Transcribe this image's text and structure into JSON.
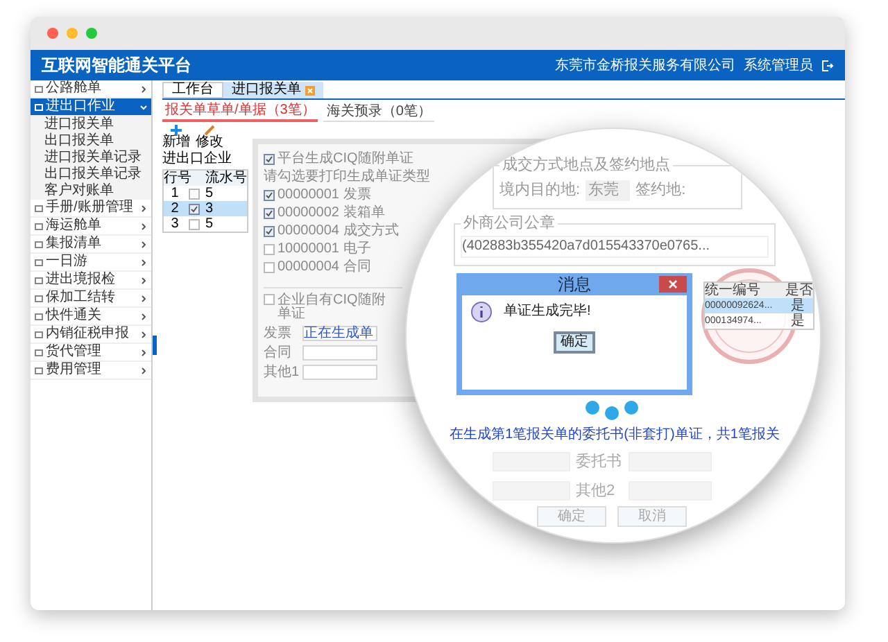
{
  "browser": {
    "dots": [
      {
        "color": "#ff5f57"
      },
      {
        "color": "#ffbd2e"
      },
      {
        "color": "#28c840"
      }
    ]
  },
  "header": {
    "title": "互联网智能通关平台",
    "company": "东莞市金桥报关服务有限公司",
    "user": "系统管理员"
  },
  "sidebar": [
    {
      "label": "公路舱单",
      "expanded": false,
      "selected": false
    },
    {
      "label": "进出口作业",
      "expanded": true,
      "selected": true,
      "children": [
        {
          "label": "进口报关单"
        },
        {
          "label": "出口报关单"
        },
        {
          "label": "进口报关单记录"
        },
        {
          "label": "出口报关单记录"
        },
        {
          "label": "客户对账单"
        }
      ]
    },
    {
      "label": "手册/账册管理",
      "expanded": false,
      "selected": false
    },
    {
      "label": "海运舱单",
      "expanded": false,
      "selected": false
    },
    {
      "label": "集报清单",
      "expanded": false,
      "selected": false
    },
    {
      "label": "一日游",
      "expanded": false,
      "selected": false
    },
    {
      "label": "进出境报检",
      "expanded": false,
      "selected": false
    },
    {
      "label": "保加工结转",
      "expanded": false,
      "selected": false
    },
    {
      "label": "快件通关",
      "expanded": false,
      "selected": false
    },
    {
      "label": "内销征税申报",
      "expanded": false,
      "selected": false
    },
    {
      "label": "货代管理",
      "expanded": false,
      "selected": false
    },
    {
      "label": "费用管理",
      "expanded": false,
      "selected": false
    }
  ],
  "tabs": [
    {
      "label": "工作台",
      "selected": false,
      "closable": false
    },
    {
      "label": "进口报关单",
      "selected": true,
      "closable": true
    }
  ],
  "subtabs": [
    {
      "label": "报关单草单/单据（3笔）",
      "selected": true
    },
    {
      "label": "海关预录（0笔）",
      "selected": false
    }
  ],
  "toolbar": [
    {
      "label": "新增",
      "kind": "add"
    },
    {
      "label": "修改",
      "kind": "edit"
    }
  ],
  "filter": {
    "label": "进出口企业"
  },
  "table": {
    "columns": [
      "行号",
      "流水号"
    ],
    "rows": [
      {
        "no": "1",
        "checked": false,
        "selected": false,
        "value": "5"
      },
      {
        "no": "2",
        "checked": true,
        "selected": true,
        "value": "3"
      },
      {
        "no": "3",
        "checked": false,
        "selected": false,
        "value": "5"
      }
    ]
  },
  "print_dialog": {
    "platform_option": {
      "label": "平台生成CIQ随附单证",
      "checked": true
    },
    "types_label": "请勾选要打印生成单证类型",
    "types": [
      {
        "label": "00000001 发票",
        "checked": true
      },
      {
        "label": "00000002 装箱单",
        "checked": true
      },
      {
        "label": "00000004 成交方式",
        "checked": true
      },
      {
        "label": "10000001 电子",
        "checked": false
      },
      {
        "label": "00000004 合同",
        "checked": false
      }
    ],
    "own_option": {
      "label": "企业自有CIQ随附单证",
      "checked": false
    },
    "fields": [
      {
        "label": "发票",
        "value": "正在生成单"
      },
      {
        "label": "合同"
      },
      {
        "label": "其他1"
      }
    ]
  },
  "magnifier": {
    "section1": {
      "legend": "成交方式地点及签约地点",
      "dest_label": "境内目的地:",
      "dest_value": "东莞",
      "sign_label": "签约地:"
    },
    "section2": {
      "legend": "外商公司公章",
      "value": "(402883b355420a7d015543370e0765..."
    },
    "table": {
      "columns": [
        "统一编号",
        "是否"
      ],
      "rows": [
        {
          "cells": [
            "00000092624...",
            "是"
          ],
          "selected": true
        },
        {
          "cells": [
            "000134974...",
            "是"
          ],
          "selected": false
        }
      ]
    },
    "status": "在生成第1笔报关单的委托书(非套打)单证，共1笔报关",
    "fields": [
      {
        "label": "委托书"
      },
      {
        "label": "其他2"
      }
    ],
    "buttons": [
      "确定",
      "取消"
    ]
  },
  "message": {
    "title": "消息",
    "text": "单证生成完毕!",
    "button": "确定"
  }
}
